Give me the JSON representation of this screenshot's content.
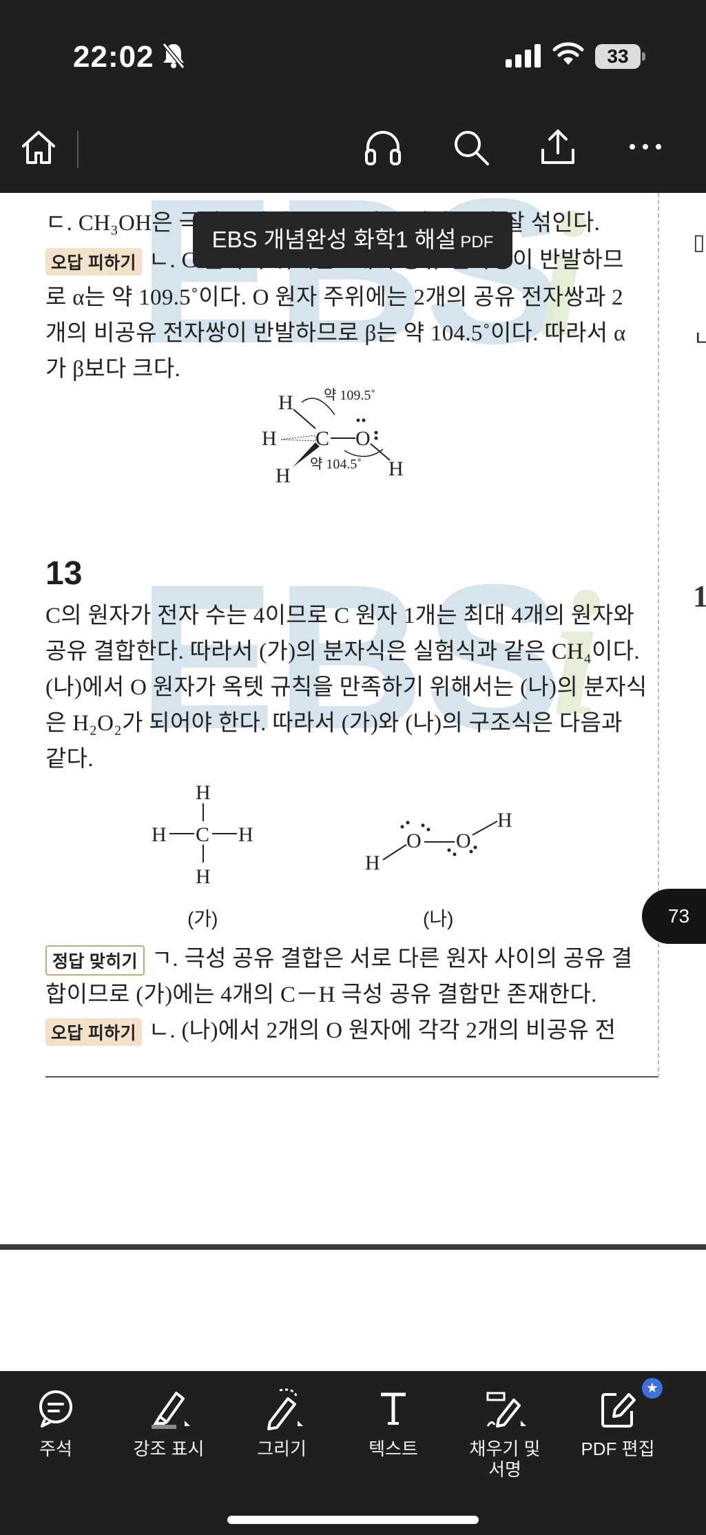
{
  "status": {
    "time": "22:02",
    "battery": "33"
  },
  "doc": {
    "title": "EBS 개념완성 화학1 해설",
    "title_suffix": "PDF",
    "page_number": "73"
  },
  "content": {
    "q12_line1": "ㄷ. CH₃OH은 극성 분자이므로 극성 용매인 물과 잘 섞인다.",
    "q12_tag_wrong": "오답 피하기",
    "q12_line2": "ㄴ. C 원자 주위에는 4개의 공유 전자쌍이 반발하므",
    "q12_line3": "로 α는 약 109.5˚이다. O 원자 주위에는 2개의 공유 전자쌍과 2",
    "q12_line4": "개의 비공유 전자쌍이 반발하므로 β는 약 104.5˚이다. 따라서 α",
    "q12_line5": "가 β보다 크다.",
    "mol_angle1": "약 109.5˚",
    "mol_angle2": "약 104.5˚",
    "q13_number": "13",
    "q13_line1": "C의 원자가 전자 수는 4이므로 C 원자 1개는 최대 4개의 원자와",
    "q13_line2": "공유 결합한다. 따라서 (가)의 분자식은 실험식과 같은 CH₄이다.",
    "q13_line3": "(나)에서 O 원자가 옥텟 규칙을 만족하기 위해서는 (나)의 분자식",
    "q13_line4": "은 H₂O₂가 되어야 한다. 따라서 (가)와 (나)의 구조식은 다음과",
    "q13_line5": "같다.",
    "label_ga": "(가)",
    "label_na": "(나)",
    "q13_tag_right": "정답 맞히기",
    "q13_line6": "ㄱ. 극성 공유 결합은 서로 다른 원자 사이의 공유 결",
    "q13_line7": "합이므로 (가)에는 4개의 C－H 극성 공유 결합만 존재한다.",
    "q13_tag_wrong": "오답 피하기",
    "q13_line8": "ㄴ. (나)에서 2개의 O 원자에 각각 2개의 비공유 전"
  },
  "toolbar_bottom": {
    "comment": "주석",
    "highlight": "강조 표시",
    "draw": "그리기",
    "text": "텍스트",
    "fill_sign_1": "채우기 및",
    "fill_sign_2": "서명",
    "edit_pdf": "PDF 편집"
  }
}
